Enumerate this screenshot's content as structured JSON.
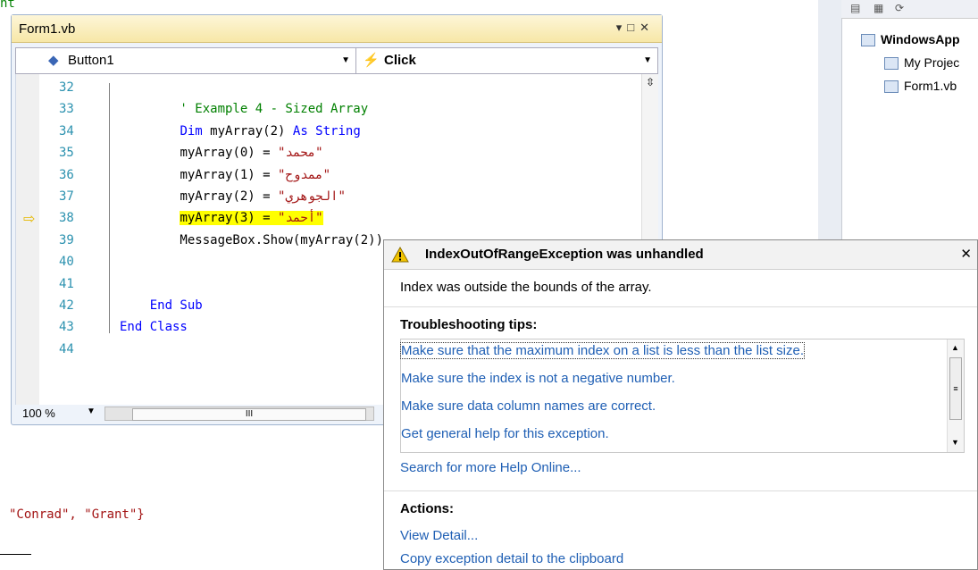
{
  "background": {
    "top_fragment": "nt",
    "bottom_code_tail": "\"Conrad\", \"Grant\"}"
  },
  "editor": {
    "title": "Form1.vb",
    "class_combo": "Button1",
    "method_combo": "Click",
    "zoom": "100 %",
    "lines": [
      {
        "num": "32",
        "indent": "",
        "kind": "blank",
        "text": ""
      },
      {
        "num": "33",
        "indent": "        ",
        "kind": "comment",
        "text": "' Example 4 - Sized Array"
      },
      {
        "num": "34",
        "indent": "        ",
        "kind": "dim",
        "text": "Dim myArray(2) As String"
      },
      {
        "num": "35",
        "indent": "        ",
        "kind": "assign",
        "text": "myArray(0) = \"محمد\""
      },
      {
        "num": "36",
        "indent": "        ",
        "kind": "assign",
        "text": "myArray(1) = \"ممدوح\""
      },
      {
        "num": "37",
        "indent": "        ",
        "kind": "assign",
        "text": "myArray(2) = \"الجوهري\""
      },
      {
        "num": "38",
        "indent": "        ",
        "kind": "current",
        "text": "myArray(3) = \"أحمد\""
      },
      {
        "num": "39",
        "indent": "        ",
        "kind": "plain",
        "text": "MessageBox.Show(myArray(2))"
      },
      {
        "num": "40",
        "indent": "",
        "kind": "blank",
        "text": ""
      },
      {
        "num": "41",
        "indent": "",
        "kind": "blank",
        "text": ""
      },
      {
        "num": "42",
        "indent": "    ",
        "kind": "end-sub",
        "text": "End Sub"
      },
      {
        "num": "43",
        "indent": "",
        "kind": "end-class",
        "text": "End Class"
      },
      {
        "num": "44",
        "indent": "",
        "kind": "blank",
        "text": ""
      }
    ]
  },
  "solution": {
    "items": [
      {
        "label": "WindowsApp",
        "bold": true
      },
      {
        "label": "My Projec",
        "bold": false
      },
      {
        "label": "Form1.vb",
        "bold": false
      }
    ]
  },
  "exception": {
    "title": "IndexOutOfRangeException was unhandled",
    "message": "Index was outside the bounds of the array.",
    "tips_heading": "Troubleshooting tips:",
    "tips": [
      "Make sure that the maximum index on a list is less than the list size.",
      "Make sure the index is not a negative number.",
      "Make sure data column names are correct.",
      "Get general help for this exception."
    ],
    "search_link": "Search for more Help Online...",
    "actions_heading": "Actions:",
    "actions": [
      "View Detail...",
      "Copy exception detail to the clipboard"
    ]
  },
  "colors": {
    "keyword": "#0000ff",
    "comment": "#008000",
    "string": "#a31515",
    "line_number": "#2b91af",
    "current_line_highlight": "#ffff00",
    "link": "#1f5fb4"
  }
}
